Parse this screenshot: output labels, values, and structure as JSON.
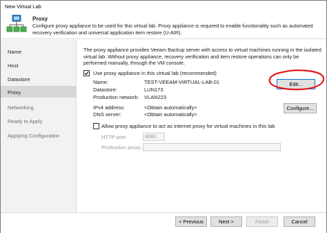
{
  "window": {
    "title": "New Virtual Lab"
  },
  "header": {
    "title": "Proxy",
    "description": "Configure proxy appliance to be used for this virtual lab. Proxy appliance is required to enable functionality such as automated recovery verification and universal application item restore (U-AIR)."
  },
  "sidebar": {
    "items": [
      {
        "label": "Name"
      },
      {
        "label": "Host"
      },
      {
        "label": "Datastore"
      },
      {
        "label": "Proxy"
      },
      {
        "label": "Networking"
      },
      {
        "label": "Ready to Apply"
      },
      {
        "label": "Applying Configuration"
      }
    ],
    "active_index": 3
  },
  "main": {
    "description": "The proxy appliance provides Veeam Backup server with access to virtual machines running in the isolated virtual lab. Without proxy appliance, recovery verification and item restore operations can only be performed manually, through the VM console.",
    "use_proxy": {
      "label": "Use proxy appliance in this virtual lab (recommended)",
      "checked": true
    },
    "fields": {
      "name_label": "Name:",
      "name_value": "TEST-VEEAM-VIRTUAL-LAB-01",
      "datastore_label": "Datastore:",
      "datastore_value": "LUN173",
      "network_label": "Production network:",
      "network_value": "VLAN223",
      "ipv4_label": "IPv4 address:",
      "ipv4_value": "<Obtain automatically>",
      "dns_label": "DNS server:",
      "dns_value": "<Obtain automatically>"
    },
    "edit_button": "Edit...",
    "configure_button": "Configure...",
    "internet_proxy": {
      "label": "Allow proxy appliance to act as internet proxy for virtual machines in this lab",
      "checked": false,
      "http_port_label": "HTTP port:",
      "http_port_value": "8080",
      "production_proxy_label": "Production proxy:",
      "production_proxy_value": ""
    }
  },
  "footer": {
    "previous": "< Previous",
    "next": "Next >",
    "finish": "Finish",
    "cancel": "Cancel"
  },
  "colors": {
    "annotation_circle": "#e01a1a",
    "focus_border": "#0078d7"
  }
}
